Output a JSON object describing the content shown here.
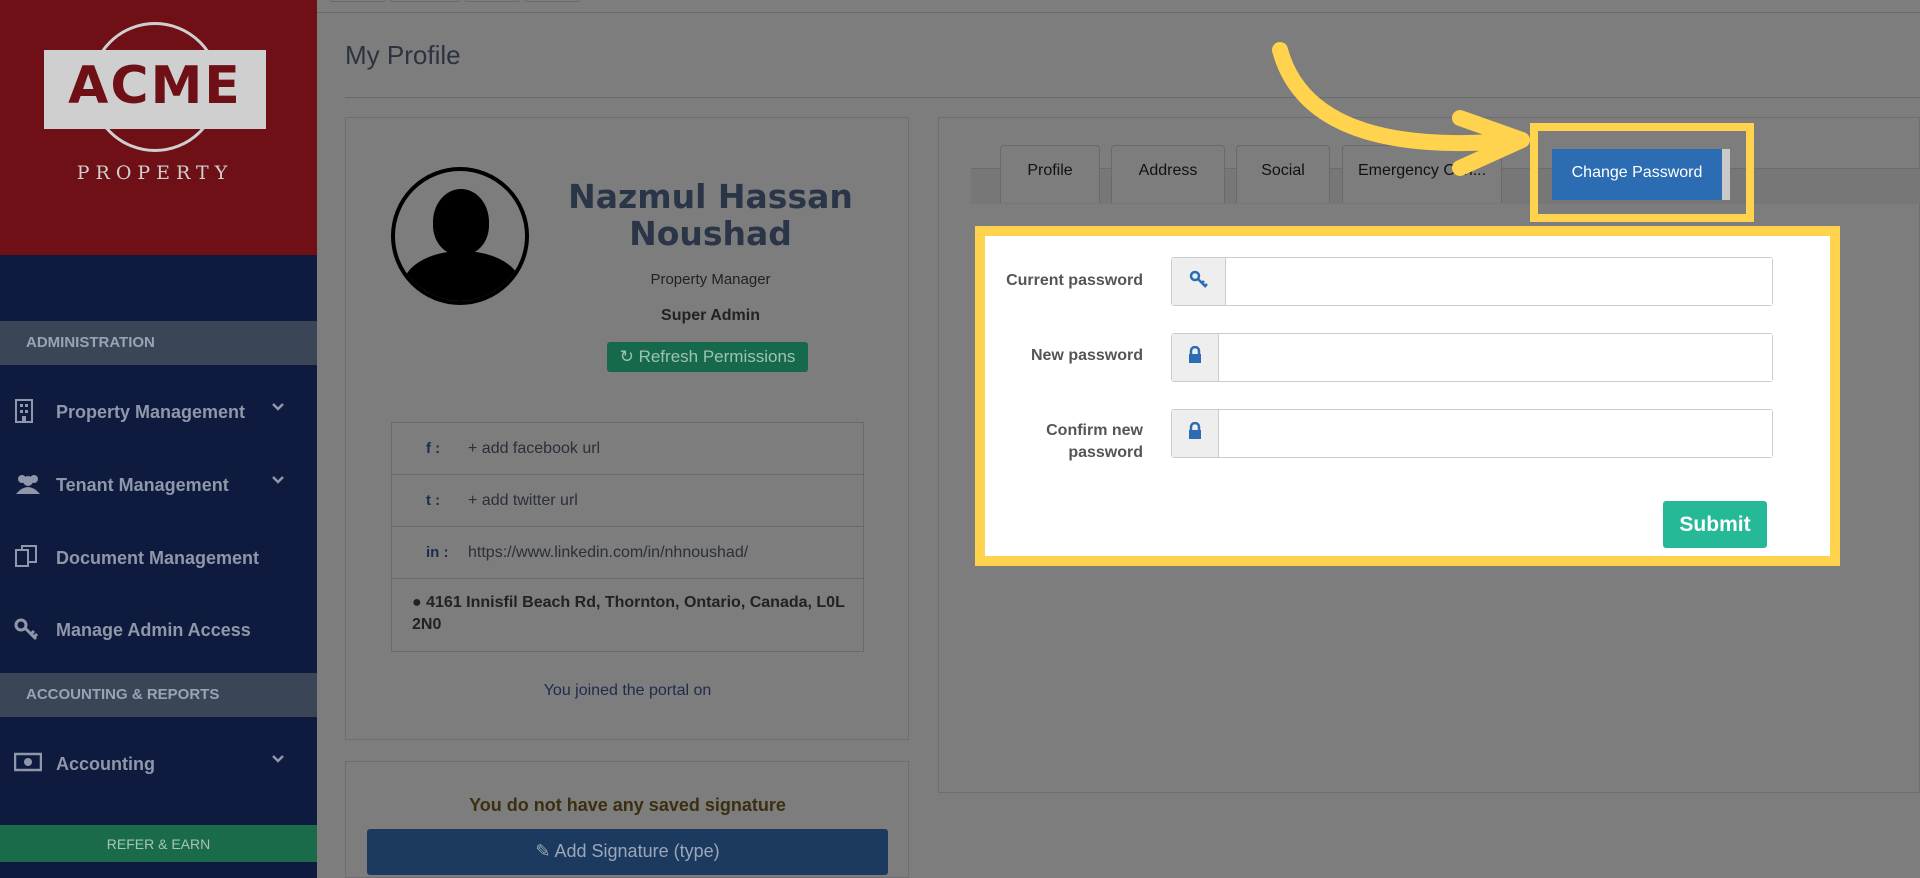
{
  "brand": {
    "name": "ACME",
    "tagline": "PROPERTY"
  },
  "sidebar": {
    "sections": [
      {
        "title": "ADMINISTRATION"
      },
      {
        "title": "ACCOUNTING & REPORTS"
      }
    ],
    "items": [
      {
        "label": "Property Management",
        "icon": "building-icon",
        "has_chevron": true
      },
      {
        "label": "Tenant Management",
        "icon": "users-icon",
        "has_chevron": true
      },
      {
        "label": "Document Management",
        "icon": "documents-icon",
        "has_chevron": false
      },
      {
        "label": "Manage Admin Access",
        "icon": "key-icon",
        "has_chevron": false
      },
      {
        "label": "Accounting",
        "icon": "money-icon",
        "has_chevron": true
      }
    ],
    "refer_label": "REFER & EARN"
  },
  "page": {
    "title": "My Profile"
  },
  "profile": {
    "name_line1": "Nazmul Hassan",
    "name_line2": "Noushad",
    "role": "Property Manager",
    "admin_level": "Super Admin",
    "refresh_label": "Refresh Permissions",
    "social": [
      {
        "icon": "facebook-icon",
        "value": "+ add facebook url"
      },
      {
        "icon": "twitter-icon",
        "value": "+ add twitter url"
      },
      {
        "icon": "linkedin-icon",
        "value": "https://www.linkedin.com/in/nhnoushad/"
      }
    ],
    "address": "4161 Innisfil Beach Rd, Thornton, Ontario, Canada, L0L 2N0",
    "joined_text": "You joined the portal on"
  },
  "signature": {
    "message": "You do not have any saved signature",
    "button_label": "Add Signature (type)"
  },
  "tabs": [
    {
      "label": "Profile"
    },
    {
      "label": "Address"
    },
    {
      "label": "Social"
    },
    {
      "label": "Emergency Con..."
    },
    {
      "label": "Change Password",
      "active": true
    }
  ],
  "form": {
    "fields": [
      {
        "label": "Current password",
        "icon": "key-icon",
        "value": ""
      },
      {
        "label": "New password",
        "icon": "lock-icon",
        "value": ""
      },
      {
        "label_line1": "Confirm new",
        "label_line2": "password",
        "icon": "lock-icon",
        "value": ""
      }
    ],
    "submit_label": "Submit"
  },
  "colors": {
    "highlight": "#ffd34d",
    "active_tab": "#2b6cb3",
    "submit": "#26b998"
  }
}
